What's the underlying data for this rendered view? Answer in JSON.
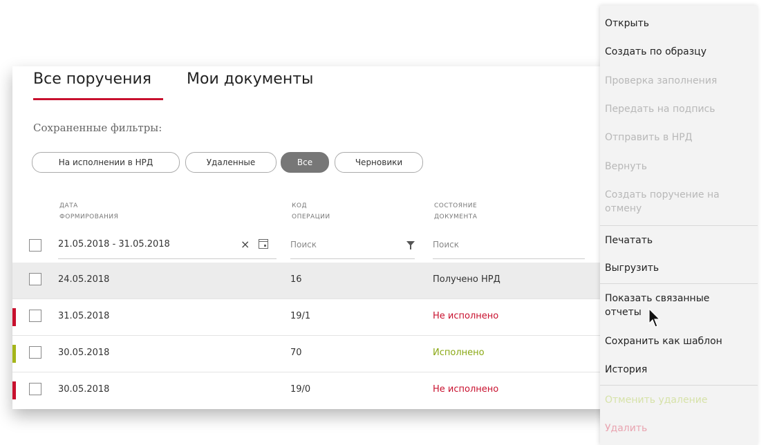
{
  "tabs": [
    {
      "label": "Все поручения",
      "active": true
    },
    {
      "label": "Мои документы",
      "active": false
    }
  ],
  "saved_filters": {
    "label": "Сохраненные фильтры:",
    "chips": [
      {
        "label": "На исполнении в НРД",
        "active": false
      },
      {
        "label": "Удаленные",
        "active": false
      },
      {
        "label": "Все",
        "active": true
      },
      {
        "label": "Черновики",
        "active": false
      }
    ]
  },
  "table": {
    "columns": [
      {
        "line1": "ДАТА",
        "line2": "ФОРМИРОВАНИЯ"
      },
      {
        "line1": "КОД",
        "line2": "ОПЕРАЦИИ"
      },
      {
        "line1": "СОСТОЯНИЕ",
        "line2": "ДОКУМЕНТА"
      }
    ],
    "filters": {
      "date_range": "21.05.2018 - 31.05.2018",
      "clear_symbol": "×",
      "code_placeholder": "Поиск",
      "state_placeholder": "Поиск"
    },
    "rows": [
      {
        "date": "24.05.2018",
        "code": "16",
        "state": "Получено НРД",
        "marker": "",
        "state_color": "#333333",
        "selected": true
      },
      {
        "date": "31.05.2018",
        "code": "19/1",
        "state": "Не исполнено",
        "marker": "#c8102e",
        "state_color": "#c8102e",
        "selected": false
      },
      {
        "date": "30.05.2018",
        "code": "70",
        "state": "Исполнено",
        "marker": "#a5b51a",
        "state_color": "#8aa814",
        "selected": false
      },
      {
        "date": "30.05.2018",
        "code": "19/0",
        "state": "Не исполнено",
        "marker": "#c8102e",
        "state_color": "#c8102e",
        "selected": false
      }
    ]
  },
  "context_menu": {
    "items": [
      {
        "label": "Открыть",
        "state": "enabled"
      },
      {
        "label": "Создать по образцу",
        "state": "enabled"
      },
      {
        "label": "Проверка заполнения",
        "state": "disabled"
      },
      {
        "label": "Передать на подпись",
        "state": "disabled"
      },
      {
        "label": "Отправить в НРД",
        "state": "disabled"
      },
      {
        "label": "Вернуть",
        "state": "disabled"
      },
      {
        "label": "Создать поручение на",
        "label2": "отмену",
        "state": "disabled"
      },
      {
        "label": "Печатать",
        "state": "enabled"
      },
      {
        "label": "Выгрузить",
        "state": "enabled"
      },
      {
        "label": "Показать связанные",
        "label2": "отчеты",
        "state": "enabled"
      },
      {
        "label": "Сохранить как шаблон",
        "state": "enabled"
      },
      {
        "label": "История",
        "state": "enabled"
      },
      {
        "label": "Отменить удаление",
        "state": "disabled-green"
      },
      {
        "label": "Удалить",
        "state": "disabled-red"
      }
    ]
  },
  "colors": {
    "accent_red": "#c8102e",
    "success_green": "#a5b51a",
    "active_chip": "#777777"
  }
}
